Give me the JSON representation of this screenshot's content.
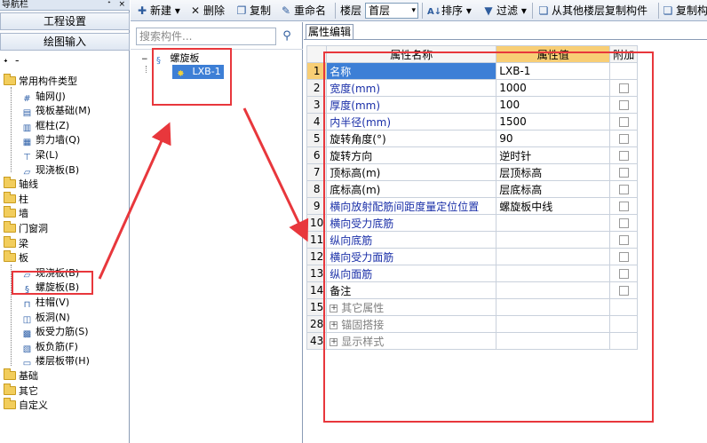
{
  "nav": {
    "header_title": "导航栏",
    "header_pins": "ᐩ ×",
    "project_settings": "工程设置",
    "drawing_input": "绘图输入",
    "toolbar_mini": "ᐩ ᐨ",
    "tree": [
      {
        "label": "常用构件类型",
        "icon": "folder-open-icon",
        "level": 0
      },
      {
        "label": "轴网(J)",
        "icon": "axis-grid-icon",
        "level": 1
      },
      {
        "label": "筏板基础(M)",
        "icon": "raft-foundation-icon",
        "level": 1
      },
      {
        "label": "框柱(Z)",
        "icon": "frame-column-icon",
        "level": 1
      },
      {
        "label": "剪力墙(Q)",
        "icon": "shear-wall-icon",
        "level": 1
      },
      {
        "label": "梁(L)",
        "icon": "beam-icon",
        "level": 1
      },
      {
        "label": "现浇板(B)",
        "icon": "slab-icon",
        "level": 1
      },
      {
        "label": "轴线",
        "icon": "folder-icon",
        "level": 0
      },
      {
        "label": "柱",
        "icon": "folder-icon",
        "level": 0
      },
      {
        "label": "墙",
        "icon": "folder-icon",
        "level": 0
      },
      {
        "label": "门窗洞",
        "icon": "folder-icon",
        "level": 0
      },
      {
        "label": "梁",
        "icon": "folder-icon",
        "level": 0
      },
      {
        "label": "板",
        "icon": "folder-open-icon",
        "level": 0
      },
      {
        "label": "现浇板(B)",
        "icon": "slab-icon",
        "level": 1
      },
      {
        "label": "螺旋板(B)",
        "icon": "spiral-slab-icon",
        "level": 1
      },
      {
        "label": "柱帽(V)",
        "icon": "column-cap-icon",
        "level": 1
      },
      {
        "label": "板洞(N)",
        "icon": "slab-hole-icon",
        "level": 1
      },
      {
        "label": "板受力筋(S)",
        "icon": "slab-rebar-icon",
        "level": 1
      },
      {
        "label": "板负筋(F)",
        "icon": "negative-rebar-icon",
        "level": 1
      },
      {
        "label": "楼层板带(H)",
        "icon": "slab-strip-icon",
        "level": 1
      },
      {
        "label": "基础",
        "icon": "folder-icon",
        "level": 0
      },
      {
        "label": "其它",
        "icon": "folder-icon",
        "level": 0
      },
      {
        "label": "自定义",
        "icon": "folder-icon",
        "level": 0
      }
    ]
  },
  "toolbar": {
    "new": "新建",
    "delete": "删除",
    "copy": "复制",
    "rename": "重命名",
    "floor_label": "楼层",
    "floor_value": "首层",
    "sort": "排序",
    "filter": "过滤",
    "copy_from_floor": "从其他楼层复制构件",
    "copy_to": "复制构"
  },
  "components": {
    "search_placeholder": "搜索构件...",
    "root": "螺旋板",
    "child": "LXB-1"
  },
  "props": {
    "tab": "属性编辑",
    "headers": {
      "name": "属性名称",
      "value": "属性值",
      "extra": "附加"
    },
    "rows": [
      {
        "num": "1",
        "name": "名称",
        "value": "LXB-1",
        "color": "black",
        "check": false,
        "selected": true
      },
      {
        "num": "2",
        "name": "宽度(mm)",
        "value": "1000",
        "color": "blue",
        "check": true
      },
      {
        "num": "3",
        "name": "厚度(mm)",
        "value": "100",
        "color": "blue",
        "check": true
      },
      {
        "num": "4",
        "name": "内半径(mm)",
        "value": "1500",
        "color": "blue",
        "check": true
      },
      {
        "num": "5",
        "name": "旋转角度(°)",
        "value": "90",
        "color": "black",
        "check": true
      },
      {
        "num": "6",
        "name": "旋转方向",
        "value": "逆时针",
        "color": "black",
        "check": true
      },
      {
        "num": "7",
        "name": "顶标高(m)",
        "value": "层顶标高",
        "color": "black",
        "check": true
      },
      {
        "num": "8",
        "name": "底标高(m)",
        "value": "层底标高",
        "color": "black",
        "check": true
      },
      {
        "num": "9",
        "name": "横向放射配筋间距度量定位位置",
        "value": "螺旋板中线",
        "color": "blue",
        "check": true
      },
      {
        "num": "10",
        "name": "横向受力底筋",
        "value": "",
        "color": "blue",
        "check": true
      },
      {
        "num": "11",
        "name": "纵向底筋",
        "value": "",
        "color": "blue",
        "check": true
      },
      {
        "num": "12",
        "name": "横向受力面筋",
        "value": "",
        "color": "blue",
        "check": true
      },
      {
        "num": "13",
        "name": "纵向面筋",
        "value": "",
        "color": "blue",
        "check": true
      },
      {
        "num": "14",
        "name": "备注",
        "value": "",
        "color": "black",
        "check": true
      },
      {
        "num": "15",
        "name": "其它属性",
        "value": "",
        "color": "gray",
        "group": true
      },
      {
        "num": "28",
        "name": "锚固搭接",
        "value": "",
        "color": "gray",
        "group": true
      },
      {
        "num": "43",
        "name": "显示样式",
        "value": "",
        "color": "gray",
        "group": true
      }
    ]
  },
  "colors": {
    "annotation_red": "#e8373c",
    "selection_blue": "#3d7fd6",
    "header_orange": "#f8ce75",
    "property_blue": "#1a2fa8"
  }
}
